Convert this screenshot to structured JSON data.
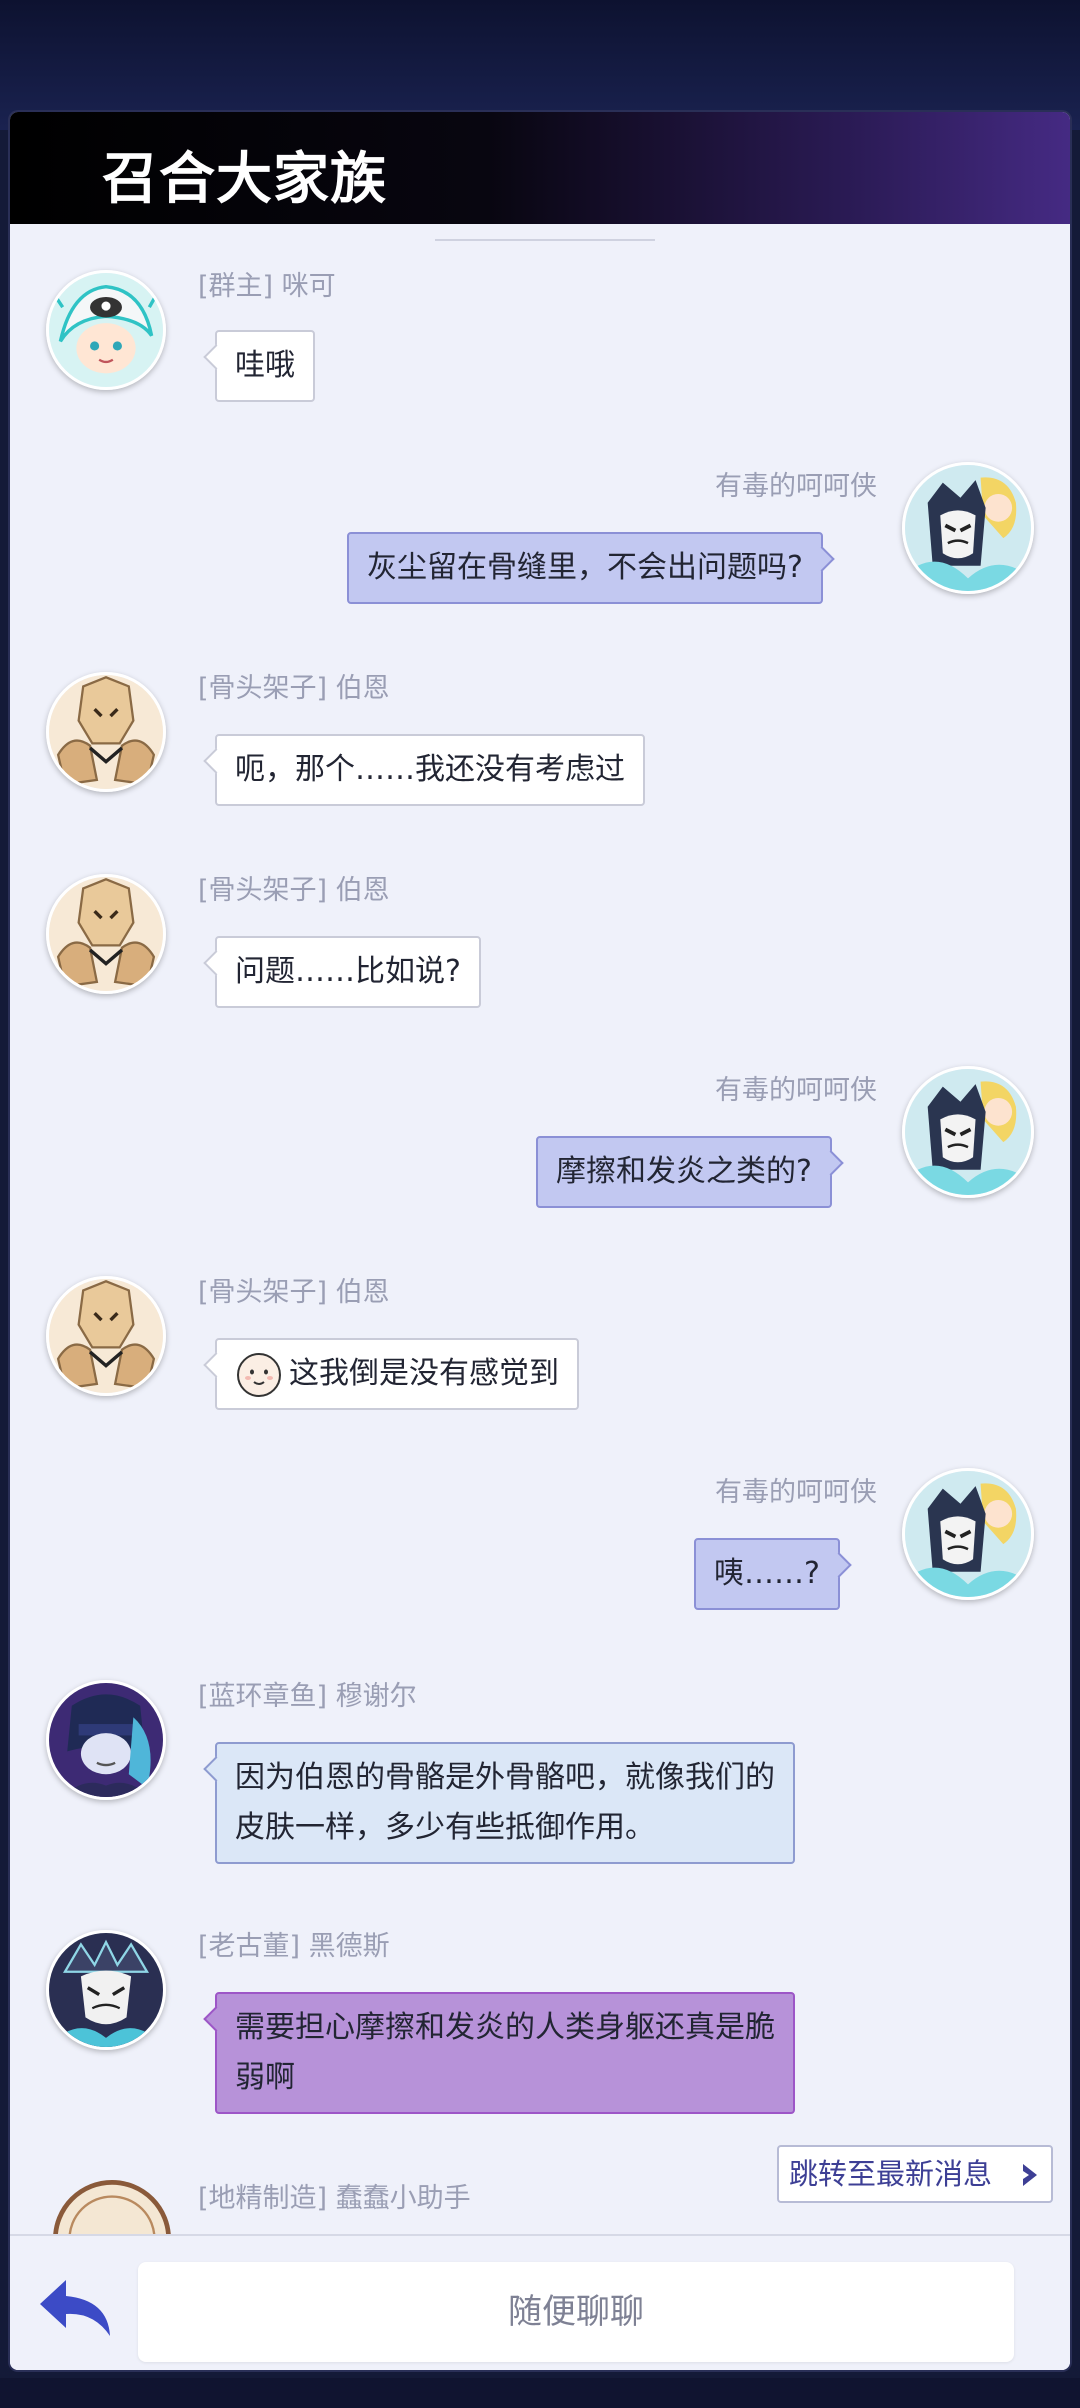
{
  "header": {
    "title": "召合大家族"
  },
  "messages": [
    {
      "side": "left",
      "name": "[群主] 咪可",
      "text": "哇哦",
      "style": "default",
      "avatar": "mico-avatar"
    },
    {
      "side": "right",
      "name": "有毒的呵呵侠",
      "text": "灰尘留在骨缝里，不会出问题吗?",
      "avatar": "player-avatar"
    },
    {
      "side": "left",
      "name": "[骨头架子] 伯恩",
      "text": "呃，那个……我还没有考虑过",
      "style": "default",
      "avatar": "bone-avatar"
    },
    {
      "side": "left",
      "name": "[骨头架子] 伯恩",
      "text": "问题……比如说?",
      "style": "default",
      "avatar": "bone-avatar"
    },
    {
      "side": "right",
      "name": "有毒的呵呵侠",
      "text": "摩擦和发炎之类的?",
      "avatar": "player-avatar"
    },
    {
      "side": "left",
      "name": "[骨头架子] 伯恩",
      "text": "这我倒是没有感觉到",
      "style": "default",
      "emoji": "smiling-face-icon",
      "avatar": "bone-avatar"
    },
    {
      "side": "right",
      "name": "有毒的呵呵侠",
      "text": "咦……?",
      "avatar": "player-avatar"
    },
    {
      "side": "left",
      "name": "[蓝环章鱼] 穆谢尔",
      "text": "因为伯恩的骨骼是外骨骼吧，就像我们的皮肤一样，多少有些抵御作用。",
      "style": "blue",
      "avatar": "octopus-avatar"
    },
    {
      "side": "left",
      "name": "[老古董] 黑德斯",
      "text": "需要担心摩擦和发炎的人类身躯还真是脆弱啊",
      "style": "purple",
      "avatar": "hades-avatar"
    },
    {
      "side": "left",
      "name": "[地精制造] 蠢蠢小助手",
      "text": "",
      "style": "partial",
      "avatar": "goblin-avatar"
    }
  ],
  "jump_button": {
    "label": "跳转至最新消息"
  },
  "input": {
    "placeholder": "随便聊聊"
  },
  "icons": {
    "back": "reply-arrow-icon",
    "jump": "chevron-right-icon"
  },
  "colors": {
    "window_bg": "#eff1fa",
    "self_bubble": "#c2c8f1",
    "blue_bubble": "#dbe7f7",
    "purple_bubble": "#b792d9",
    "name_text": "#9a9eb4",
    "accent": "#3d3f95"
  }
}
